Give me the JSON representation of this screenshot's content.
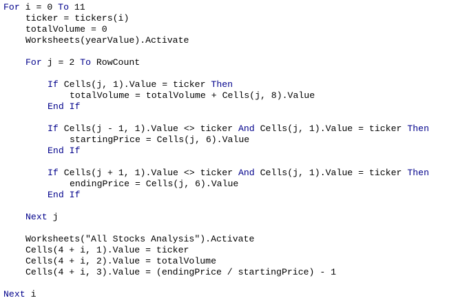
{
  "colors": {
    "keyword": "#00008b",
    "text": "#000000",
    "background": "#ffffff"
  },
  "code": {
    "lines": [
      {
        "indent": 0,
        "tokens": [
          {
            "t": "For",
            "k": true
          },
          {
            "t": " i = 0 "
          },
          {
            "t": "To",
            "k": true
          },
          {
            "t": " 11"
          }
        ]
      },
      {
        "indent": 1,
        "tokens": [
          {
            "t": "ticker = tickers(i)"
          }
        ]
      },
      {
        "indent": 1,
        "tokens": [
          {
            "t": "totalVolume = 0"
          }
        ]
      },
      {
        "indent": 1,
        "tokens": [
          {
            "t": "Worksheets(yearValue).Activate"
          }
        ]
      },
      {
        "indent": 0,
        "tokens": []
      },
      {
        "indent": 1,
        "tokens": [
          {
            "t": "For",
            "k": true
          },
          {
            "t": " j = 2 "
          },
          {
            "t": "To",
            "k": true
          },
          {
            "t": " RowCount"
          }
        ]
      },
      {
        "indent": 0,
        "tokens": []
      },
      {
        "indent": 2,
        "tokens": [
          {
            "t": "If",
            "k": true
          },
          {
            "t": " Cells(j, 1).Value = ticker "
          },
          {
            "t": "Then",
            "k": true
          }
        ]
      },
      {
        "indent": 3,
        "tokens": [
          {
            "t": "totalVolume = totalVolume + Cells(j, 8).Value"
          }
        ]
      },
      {
        "indent": 2,
        "tokens": [
          {
            "t": "End If",
            "k": true
          }
        ]
      },
      {
        "indent": 0,
        "tokens": []
      },
      {
        "indent": 2,
        "tokens": [
          {
            "t": "If",
            "k": true
          },
          {
            "t": " Cells(j - 1, 1).Value <> ticker "
          },
          {
            "t": "And",
            "k": true
          },
          {
            "t": " Cells(j, 1).Value = ticker "
          },
          {
            "t": "Then",
            "k": true
          }
        ]
      },
      {
        "indent": 3,
        "tokens": [
          {
            "t": "startingPrice = Cells(j, 6).Value"
          }
        ]
      },
      {
        "indent": 2,
        "tokens": [
          {
            "t": "End If",
            "k": true
          }
        ]
      },
      {
        "indent": 0,
        "tokens": []
      },
      {
        "indent": 2,
        "tokens": [
          {
            "t": "If",
            "k": true
          },
          {
            "t": " Cells(j + 1, 1).Value <> ticker "
          },
          {
            "t": "And",
            "k": true
          },
          {
            "t": " Cells(j, 1).Value = ticker "
          },
          {
            "t": "Then",
            "k": true
          }
        ]
      },
      {
        "indent": 3,
        "tokens": [
          {
            "t": "endingPrice = Cells(j, 6).Value"
          }
        ]
      },
      {
        "indent": 2,
        "tokens": [
          {
            "t": "End If",
            "k": true
          }
        ]
      },
      {
        "indent": 0,
        "tokens": []
      },
      {
        "indent": 1,
        "tokens": [
          {
            "t": "Next",
            "k": true
          },
          {
            "t": " j"
          }
        ]
      },
      {
        "indent": 0,
        "tokens": []
      },
      {
        "indent": 1,
        "tokens": [
          {
            "t": "Worksheets(\"All Stocks Analysis\").Activate"
          }
        ]
      },
      {
        "indent": 1,
        "tokens": [
          {
            "t": "Cells(4 + i, 1).Value = ticker"
          }
        ]
      },
      {
        "indent": 1,
        "tokens": [
          {
            "t": "Cells(4 + i, 2).Value = totalVolume"
          }
        ]
      },
      {
        "indent": 1,
        "tokens": [
          {
            "t": "Cells(4 + i, 3).Value = (endingPrice / startingPrice) - 1"
          }
        ]
      },
      {
        "indent": 0,
        "tokens": []
      },
      {
        "indent": 0,
        "tokens": [
          {
            "t": "Next",
            "k": true
          },
          {
            "t": " i"
          }
        ]
      }
    ]
  }
}
